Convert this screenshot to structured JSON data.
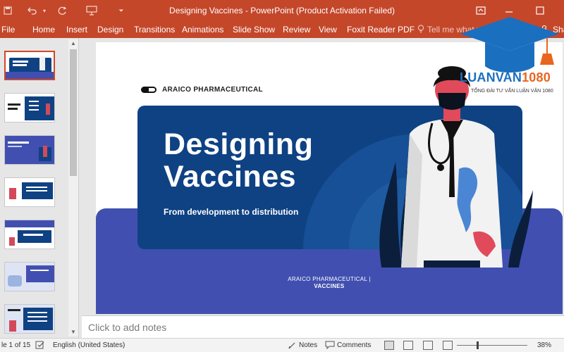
{
  "window": {
    "title": "Designing Vaccines - PowerPoint (Product Activation Failed)",
    "undo_icon": "undo-icon",
    "redo_icon": "redo-icon",
    "restore_icon": "restore-icon",
    "minimize_icon": "minimize-icon",
    "maximize_icon": "maximize-icon"
  },
  "ribbon": {
    "tabs": [
      "File",
      "Home",
      "Insert",
      "Design",
      "Transitions",
      "Animations",
      "Slide Show",
      "Review",
      "View",
      "Foxit Reader PDF"
    ],
    "tell_me": "Tell me what y",
    "share": "Sha"
  },
  "thumbnails": {
    "count": 7,
    "active_index": 0
  },
  "slide": {
    "brand": "ARAICO PHARMACEUTICAL",
    "title_line1": "Designing",
    "title_line2": "Vaccines",
    "subtitle": "From development to distribution",
    "footer_line1": "ARAICO PHARMACEUTICAL |",
    "footer_line2": "VACCINES",
    "colors": {
      "hero": "#0f4283",
      "band": "#4150b0",
      "accent": "#c4472a"
    }
  },
  "watermark": {
    "name_part1": "LUANVAN",
    "name_part2": "1080",
    "tagline": "TỔNG ĐÀI TƯ VẤN LUẬN VĂN 1080"
  },
  "notes": {
    "placeholder": "Click to add notes"
  },
  "status": {
    "slide_info": "le 1 of 15",
    "language": "English (United States)",
    "notes": "Notes",
    "comments": "Comments",
    "zoom": "38%"
  }
}
